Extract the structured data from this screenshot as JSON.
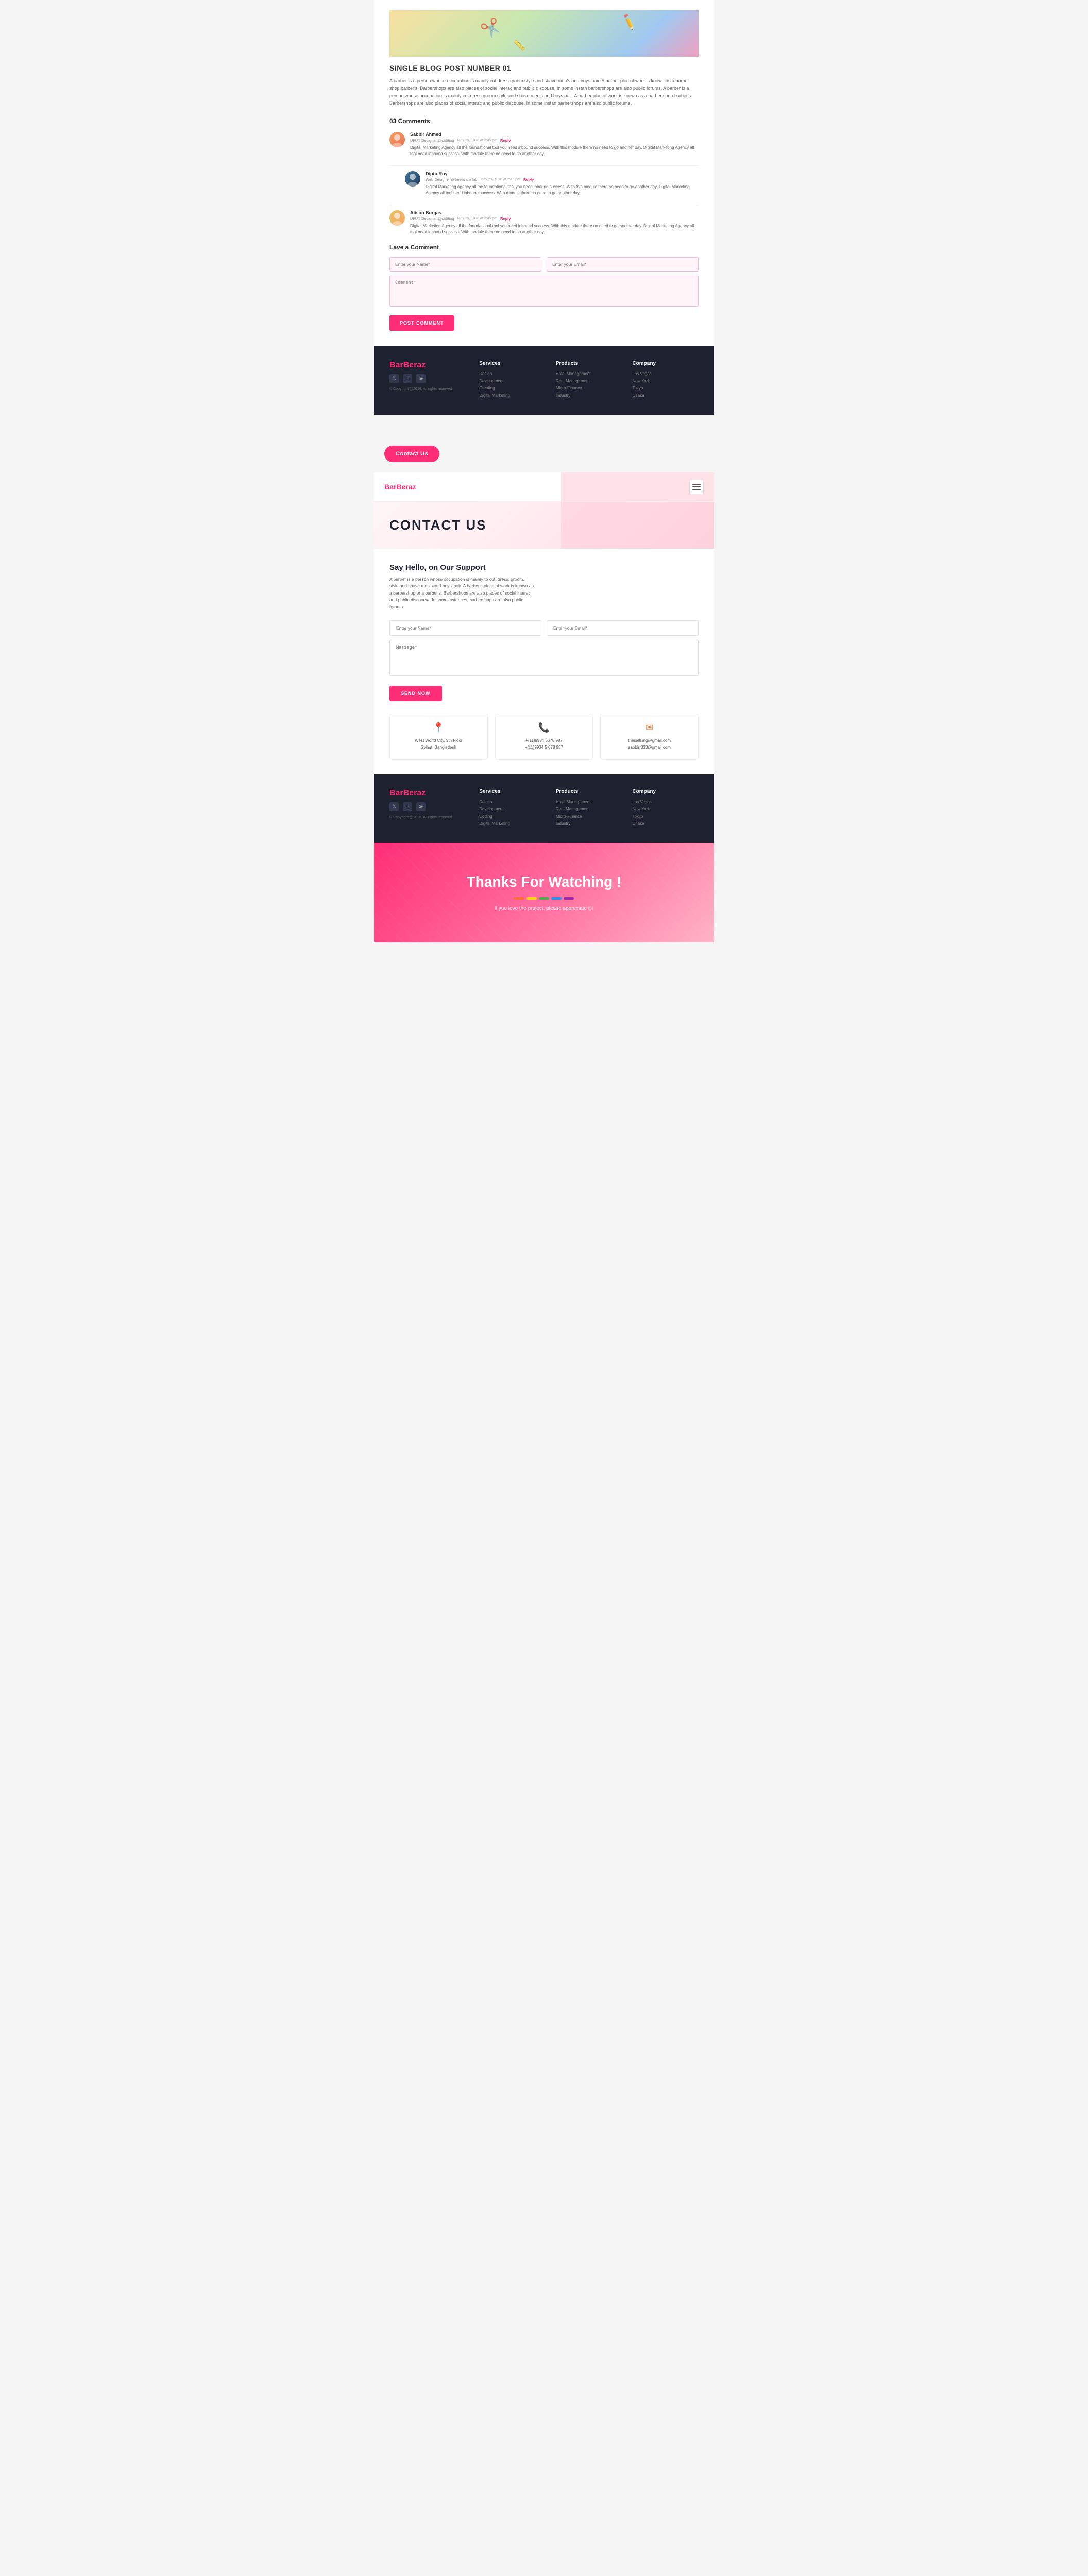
{
  "blog": {
    "image_alt": "Blog post header image with scissors and pencils",
    "title": "SINGLE BLOG POST NUMBER 01",
    "description": "A barber is a person whose occupation is mainly cut dress groom style and shave men's and boys hair. A barber ploc of work is known as a barber shop barber's. Barbershops are also places of social interac and public discouse. In some instan barbershops are also public forums. A barber is a person whose occupation is mainly cut dress groom style and shave men's and boys hair. A barber ploc of work is known as a barber shop barber's. Barbershops are also places of social interac and public discouse. In some instan barbershops are also public forums.",
    "comments_count": "03 Comments",
    "comments": [
      {
        "name": "Sabbir Ahmed",
        "role": "UI/UX Designer @softling",
        "date": "May 29, 1018 at 2:45 pm",
        "reply_label": "Reply",
        "text": "Digital Marketing Agency all the foundational tool you need inbound success. With this module there no need to go another day. Digital Marketing Agency all tool need inbound success. With module there no need to go another day.",
        "nested": false
      },
      {
        "name": "Dipto Roy",
        "role": "Web Designer @freelancerlab",
        "date": "May 29, 1018 at 2:45 pm",
        "reply_label": "Reply",
        "text": "Digital Marketing Agency all the foundational tool you need inbound success. With this module there no need to go another day. Digital Marketing Agency all tool need inbound success. With module there no need to go another day.",
        "nested": true
      },
      {
        "name": "Alison Burgas",
        "role": "UI/UX Designer @softling",
        "date": "May 29, 1018 at 2:45 pm",
        "reply_label": "Reply",
        "text": "Digital Marketing Agency all the foundational tool you need inbound success. With this module there no need to go another day. Digital Marketing Agency all tool need inbound success. With module there no need to go another day.",
        "nested": false
      }
    ],
    "leave_comment_title": "Lave a Comment",
    "name_placeholder": "Enter your Name*",
    "email_placeholder": "Enter your Email*",
    "comment_placeholder": "Comment*",
    "post_button": "POST COMMENT"
  },
  "footer1": {
    "logo_bar": "Bar",
    "logo_beraz": "Beraz",
    "copyright": "© Copyright @2018. All rights reserved",
    "social": [
      "𝕏",
      "in",
      "📷"
    ],
    "services_title": "Services",
    "services": [
      "Design",
      "Development",
      "Creating",
      "Digital Marketing"
    ],
    "products_title": "Products",
    "products": [
      "Hotel Management",
      "Rent Management",
      "Micro-Finance",
      "Industry"
    ],
    "company_title": "Company",
    "company": [
      "Las Vegas",
      "New York",
      "Tokyo",
      "Osaka"
    ]
  },
  "contact_label": "Contact Us",
  "contact_page": {
    "logo_bar": "Bar",
    "logo_beraz": "Beraz",
    "hero_title": "CONTACT US",
    "form_section_title": "Say Hello, on Our Support",
    "form_description": "A barber is a person whose occupation is mainly to cut, dress, groom, style and shave men's and boys' hair. A barber's place of work is known as a barbershop or a barber's. Barbershops are also places of social interac and public discourse. In some instances, barbershops are also public forums.",
    "name_placeholder": "Enter your Name*",
    "email_placeholder": "Enter your Email*",
    "message_placeholder": "Massage*",
    "send_button": "SEND NOW",
    "address_icon": "📍",
    "address_text": "West World City, 9th Floor\nSylhet, Bangladesh",
    "phone_icon": "📞",
    "phone1": "+(11)9934 5678 987",
    "phone2": "+(11)9934 5 678 987",
    "email_icon": "✉",
    "email1": "thesaltking@gmail.com",
    "email2": "sabbirr333@gmail.com"
  },
  "footer2": {
    "logo_bar": "Bar",
    "logo_beraz": "Beraz",
    "copyright": "© Copyright @2018. All rights reserved",
    "services_title": "Services",
    "services": [
      "Design",
      "Development",
      "Coding",
      "Digital Marketing"
    ],
    "products_title": "Products",
    "products": [
      "Hotel Management",
      "Rent Management",
      "Micro-Finance",
      "Industry"
    ],
    "company_title": "Company",
    "company": [
      "Las Vegas",
      "New York",
      "Tokyo",
      "Dhaka"
    ]
  },
  "thanks": {
    "title": "Thanks For Watching !",
    "divider_colors": [
      "#ff6b35",
      "#ffd700",
      "#4caf50",
      "#2196f3",
      "#9c27b0"
    ],
    "subtitle": "If you love the project, please appreciate it !"
  }
}
